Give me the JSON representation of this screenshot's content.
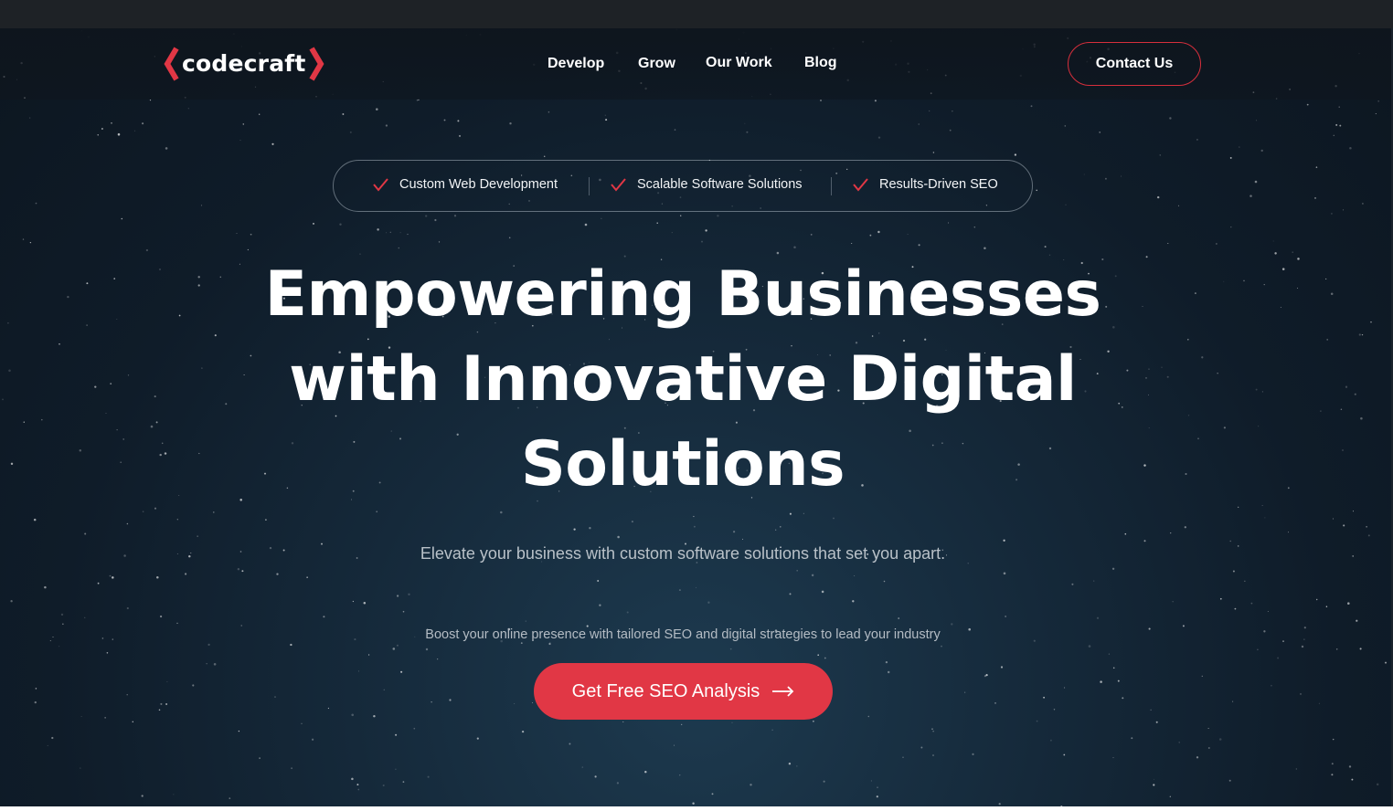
{
  "brand": {
    "logo_text": "codecraft",
    "accent_color": "#e13745"
  },
  "nav": {
    "items": [
      "Develop",
      "Grow",
      "Our Work",
      "Blog"
    ],
    "contact_label": "Contact Us"
  },
  "features": {
    "items": [
      "Custom Web Development",
      "Scalable Software Solutions",
      "Results-Driven SEO"
    ],
    "icon": "check-icon"
  },
  "hero": {
    "headline_line1": "Empowering Businesses",
    "headline_line2": "with Innovative Digital",
    "headline_line3": "Solutions",
    "subheading": "Elevate your business with custom software solutions that set you apart.",
    "tagline": "Boost your online presence with tailored SEO and digital strategies to lead your industry",
    "cta_label": "Get Free SEO Analysis"
  }
}
